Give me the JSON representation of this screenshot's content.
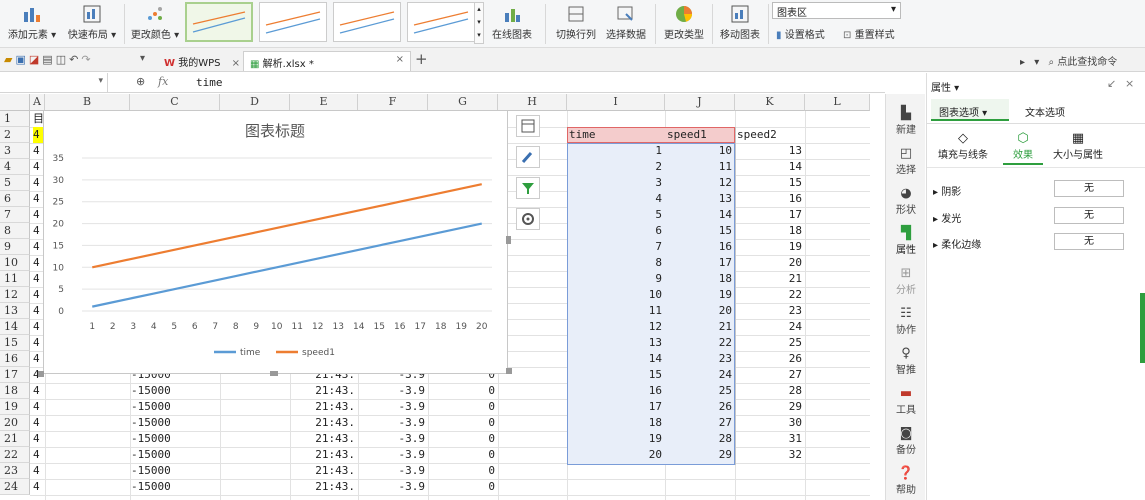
{
  "ribbon": {
    "add_element": "添加元素",
    "quick_layout": "快速布局",
    "change_color": "更改颜色",
    "online_chart": "在线图表",
    "switch_rowcol": "切换行列",
    "select_data": "选择数据",
    "change_type": "更改类型",
    "move_chart": "移动图表",
    "chart_area": "图表区",
    "set_format": "设置格式",
    "reset_style": "重置样式"
  },
  "tabbar": {
    "wps_tab": "我的WPS",
    "file_tab": "解析.xlsx *",
    "search_cmd": "点此查找命令"
  },
  "formula": {
    "fx": "fx",
    "content": "time"
  },
  "grid": {
    "columns": [
      "A",
      "B",
      "C",
      "D",
      "E",
      "F",
      "G",
      "H",
      "I",
      "J",
      "K",
      "L"
    ],
    "rows": [
      "1",
      "2",
      "3",
      "4",
      "5",
      "6",
      "7",
      "8",
      "9",
      "10",
      "11",
      "12",
      "13",
      "14",
      "15",
      "16",
      "17",
      "18",
      "19",
      "20",
      "21",
      "22",
      "23",
      "24"
    ],
    "col_a": [
      "",
      "4",
      "4",
      "4",
      "4",
      "4",
      "4",
      "4",
      "4",
      "4",
      "4",
      "4",
      "4",
      "4",
      "4",
      "4",
      "4",
      "4",
      "4",
      "4",
      "4",
      "4",
      "4",
      "4"
    ],
    "lower_rows": [
      {
        "c": "-15000",
        "e": "21:43.",
        "f": "-3.9",
        "g": "0"
      },
      {
        "c": "-15000",
        "e": "21:43.",
        "f": "-3.9",
        "g": "0"
      },
      {
        "c": "-15000",
        "e": "21:43.",
        "f": "-3.9",
        "g": "0"
      },
      {
        "c": "-15000",
        "e": "21:43.",
        "f": "-3.9",
        "g": "0"
      },
      {
        "c": "-15000",
        "e": "21:43.",
        "f": "-3.9",
        "g": "0"
      },
      {
        "c": "-15000",
        "e": "21:43.",
        "f": "-3.9",
        "g": "0"
      },
      {
        "c": "-15000",
        "e": "21:43.",
        "f": "-3.9",
        "g": "0"
      },
      {
        "c": "-15000",
        "e": "21:43.",
        "f": "-3.9",
        "g": "0"
      }
    ],
    "table_headers": [
      "time",
      "speed1",
      "speed2"
    ],
    "table_time": [
      1,
      2,
      3,
      4,
      5,
      6,
      7,
      8,
      9,
      10,
      11,
      12,
      13,
      14,
      15,
      16,
      17,
      18,
      19,
      20
    ],
    "table_speed1": [
      10,
      11,
      12,
      13,
      14,
      15,
      16,
      17,
      18,
      19,
      20,
      21,
      22,
      23,
      24,
      25,
      26,
      27,
      28,
      29
    ],
    "table_speed2": [
      13,
      14,
      15,
      16,
      17,
      18,
      19,
      20,
      21,
      22,
      23,
      24,
      25,
      26,
      27,
      28,
      29,
      30,
      31,
      32
    ]
  },
  "chart_data": {
    "type": "line",
    "title": "图表标题",
    "categories": [
      "1",
      "2",
      "3",
      "4",
      "5",
      "6",
      "7",
      "8",
      "9",
      "10",
      "11",
      "12",
      "13",
      "14",
      "15",
      "16",
      "17",
      "18",
      "19",
      "20"
    ],
    "series": [
      {
        "name": "time",
        "values": [
          1,
          2,
          3,
          4,
          5,
          6,
          7,
          8,
          9,
          10,
          11,
          12,
          13,
          14,
          15,
          16,
          17,
          18,
          19,
          20
        ],
        "color": "#5b9bd5"
      },
      {
        "name": "speed1",
        "values": [
          10,
          11,
          12,
          13,
          14,
          15,
          16,
          17,
          18,
          19,
          20,
          21,
          22,
          23,
          24,
          25,
          26,
          27,
          28,
          29
        ],
        "color": "#ed7d31"
      }
    ],
    "ylim": [
      0,
      35
    ],
    "yticks": [
      0,
      5,
      10,
      15,
      20,
      25,
      30,
      35
    ],
    "grid": true,
    "legend": "bottom"
  },
  "sidebar": {
    "new": "新建",
    "select": "选择",
    "shape": "形状",
    "property": "属性",
    "analyze": "分析",
    "collab": "协作",
    "smart": "智推",
    "tools": "工具",
    "backup": "备份",
    "help": "帮助"
  },
  "pane": {
    "title": "属性",
    "tab_chart_options": "图表选项",
    "tab_text_options": "文本选项",
    "fill_line": "填充与线条",
    "effects": "效果",
    "size_props": "大小与属性",
    "shadow": "阴影",
    "glow": "发光",
    "soft_edge": "柔化边缘",
    "none": "无"
  },
  "colors": {
    "accent_green": "#2e9e3e",
    "selection_red": "#f4cccc",
    "selection_blue": "#e8eef9"
  }
}
